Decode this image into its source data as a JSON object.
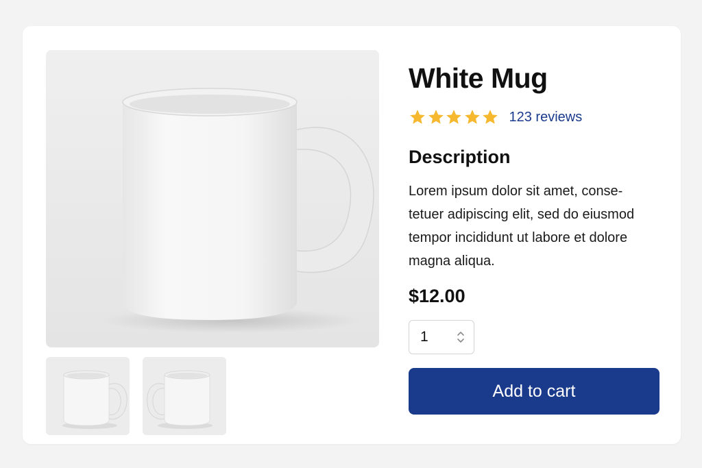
{
  "product": {
    "title": "White Mug",
    "rating": {
      "stars": 5,
      "max_stars": 5,
      "reviews_label": "123 reviews"
    },
    "description_heading": "Description",
    "description_lines": [
      "Lorem ipsum dolor sit amet, conse-",
      "tetuer adipiscing elit, sed do eiusmod",
      "tempor incididunt ut labore et dolore",
      "magna aliqua."
    ],
    "price": "$12.00",
    "quantity": "1",
    "add_to_cart_label": "Add to cart"
  },
  "gallery": {
    "main_image": "white-mug-handle-right",
    "thumbnails": [
      "white-mug-handle-right",
      "white-mug-handle-left"
    ]
  },
  "colors": {
    "accent": "#1a3a8c",
    "star": "#f5b82e",
    "link": "#1a3a8c",
    "page_background": "#f3f3f4",
    "card_background": "#ffffff"
  },
  "icons": {
    "star": "star-icon",
    "quantity_stepper": "chevron-up-down-icon"
  }
}
